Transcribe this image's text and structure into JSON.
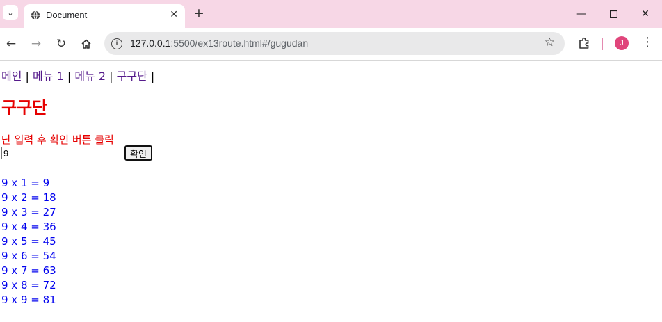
{
  "browser": {
    "tab_title": "Document",
    "url_host": "127.0.0.1",
    "url_rest": ":5500/ex13route.html#/gugudan",
    "avatar_letter": "J",
    "accent_color": "#f7d7e6"
  },
  "nav": {
    "items": [
      "메인",
      "메뉴 1",
      "메뉴 2",
      "구구단"
    ],
    "separator": "|"
  },
  "page": {
    "heading": "구구단",
    "hint": "단 입력 후 확인 버튼 클릭",
    "input_value": "9",
    "button_label": "확인"
  },
  "results": [
    "9 x 1 = 9",
    "9 x 2 = 18",
    "9 x 3 = 27",
    "9 x 4 = 36",
    "9 x 5 = 45",
    "9 x 6 = 54",
    "9 x 7 = 63",
    "9 x 8 = 72",
    "9 x 9 = 81"
  ],
  "colors": {
    "heading": "#e60000",
    "results": "#0000ee",
    "link": "#551a8b"
  }
}
